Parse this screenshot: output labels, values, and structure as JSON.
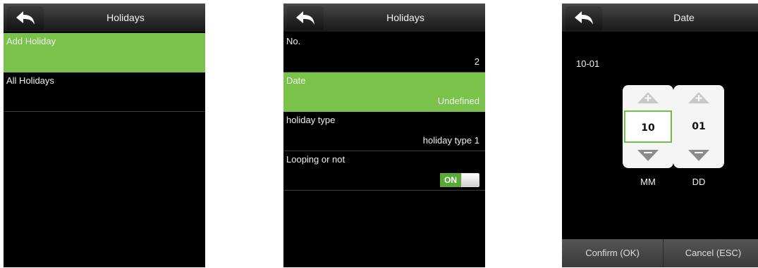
{
  "screen1": {
    "title": "Holidays",
    "items": [
      {
        "label": "Add Holiday"
      },
      {
        "label": "All Holidays"
      }
    ]
  },
  "screen2": {
    "title": "Holidays",
    "fields": [
      {
        "label": "No.",
        "value": "2"
      },
      {
        "label": "Date",
        "value": "Undefined"
      },
      {
        "label": "holiday type",
        "value": "holiday type 1"
      },
      {
        "label": "Looping or not",
        "toggle": "ON"
      }
    ]
  },
  "screen3": {
    "title": "Date",
    "date_value": "10-01",
    "month_value": "10",
    "day_value": "01",
    "month_label": "MM",
    "day_label": "DD",
    "confirm_label": "Confirm (OK)",
    "cancel_label": "Cancel (ESC)"
  },
  "colors": {
    "accent_green": "#7ac249",
    "background": "#000000",
    "titlebar": "#2c2c2c"
  },
  "icons": {
    "back": "back-arrow-icon",
    "increment": "plus-arrow-icon",
    "decrement": "down-triangle-icon"
  }
}
